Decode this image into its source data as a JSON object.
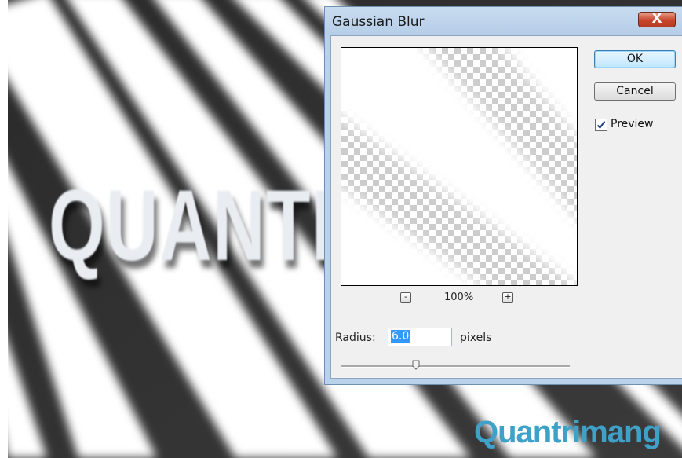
{
  "dialog": {
    "title": "Gaussian Blur",
    "close_label": "X",
    "ok_label": "OK",
    "cancel_label": "Cancel",
    "preview_label": "Preview",
    "preview_checked": true,
    "zoom": {
      "minus_label": "-",
      "plus_label": "+",
      "level": "100%"
    },
    "radius": {
      "label": "Radius:",
      "value": "6.0",
      "units": "pixels",
      "slider_fraction": 0.33
    }
  },
  "canvas": {
    "text": "QUANTRIMANG"
  },
  "watermark": {
    "text": "Quantrimang"
  },
  "colors": {
    "dialog_frame": "#b9d1ea",
    "close_button": "#c8452c",
    "selection": "#3399ff",
    "watermark": "#3fa0c8"
  },
  "icons": {
    "close": "close-icon",
    "check": "checkmark-icon",
    "slider": "slider-thumb-icon"
  }
}
